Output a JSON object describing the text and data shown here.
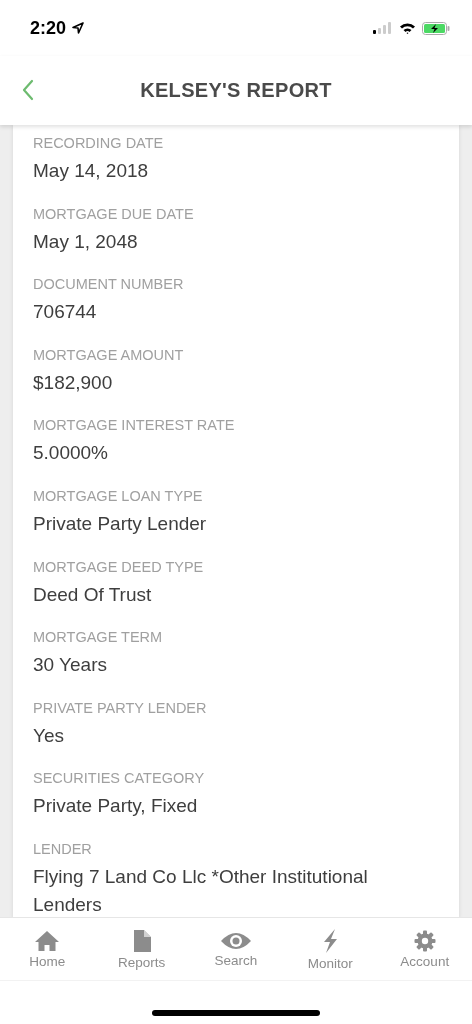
{
  "status_bar": {
    "time": "2:20"
  },
  "header": {
    "title": "KELSEY'S REPORT"
  },
  "fields": [
    {
      "label": "RECORDING DATE",
      "value": "May 14, 2018"
    },
    {
      "label": "MORTGAGE DUE DATE",
      "value": "May 1, 2048"
    },
    {
      "label": "DOCUMENT NUMBER",
      "value": "706744"
    },
    {
      "label": "MORTGAGE AMOUNT",
      "value": "$182,900"
    },
    {
      "label": "MORTGAGE INTEREST RATE",
      "value": "5.0000%"
    },
    {
      "label": "MORTGAGE LOAN TYPE",
      "value": "Private Party Lender"
    },
    {
      "label": "MORTGAGE DEED TYPE",
      "value": "Deed Of Trust"
    },
    {
      "label": "MORTGAGE TERM",
      "value": "30 Years"
    },
    {
      "label": "PRIVATE PARTY LENDER",
      "value": "Yes"
    },
    {
      "label": "SECURITIES CATEGORY",
      "value": "Private Party, Fixed"
    },
    {
      "label": "LENDER",
      "value": "Flying 7 Land Co Llc *Other Institutional Lenders"
    }
  ],
  "tab_bar": [
    {
      "label": "Home",
      "kind": "home",
      "selected": false
    },
    {
      "label": "Reports",
      "kind": "reports",
      "selected": false
    },
    {
      "label": "Search",
      "kind": "search",
      "selected": false
    },
    {
      "label": "Monitor",
      "kind": "monitor",
      "selected": false
    },
    {
      "label": "Account",
      "kind": "account",
      "selected": false
    }
  ]
}
